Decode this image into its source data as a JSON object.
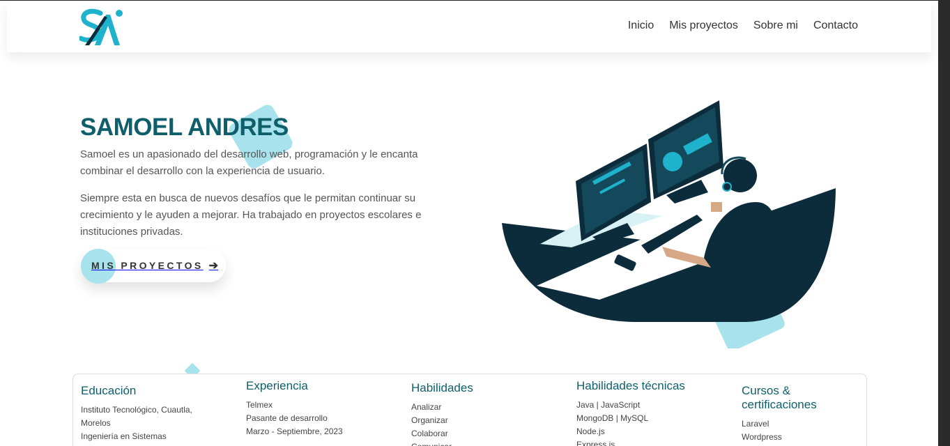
{
  "colors": {
    "primary": "#0e5f6b",
    "accent": "#a8e2ec",
    "cyan": "#1eb2cc",
    "navy": "#0c2c3b"
  },
  "header": {
    "logo": {
      "text": "SA",
      "icon": "sa-logo-icon"
    },
    "nav": [
      "Inicio",
      "Mis proyectos",
      "Sobre mi",
      "Contacto"
    ]
  },
  "hero": {
    "title": "SAMOEL ANDRES",
    "p1": "Samoel es un apasionado del desarrollo web, programación y le encanta combinar el desarrollo con la experiencia de usuario.",
    "p2": "Siempre esta en busca de nuevos desafíos que le permitan continuar su crecimiento y le ayuden a mejorar. Ha trabajado en proyectos escolares e instituciones privadas.",
    "cta_label": "MIS PROYECTOS",
    "cta_icon": "arrow-right-icon",
    "cta_arrow": "➔",
    "illustration": "developer-at-desk-illustration"
  },
  "cards": [
    {
      "title": "Educación",
      "items": [
        "Instituto Tecnológico, Cuautla, Morelos",
        "Ingeniería en Sistemas"
      ]
    },
    {
      "title": "Experiencia",
      "items": [
        "Telmex",
        "Pasante de desarrollo",
        "Marzo - Septiembre, 2023"
      ]
    },
    {
      "title": "Habilidades",
      "items": [
        "Analizar",
        "Organizar",
        "Colaborar",
        "Comunicar"
      ]
    },
    {
      "title": "Habilidades técnicas",
      "items": [
        "Java | JavaScript",
        "MongoDB | MySQL",
        "Node.js",
        "Express.js"
      ]
    },
    {
      "title": "Cursos & certificaciones",
      "items": [
        "Laravel",
        "Wordpress"
      ]
    }
  ]
}
